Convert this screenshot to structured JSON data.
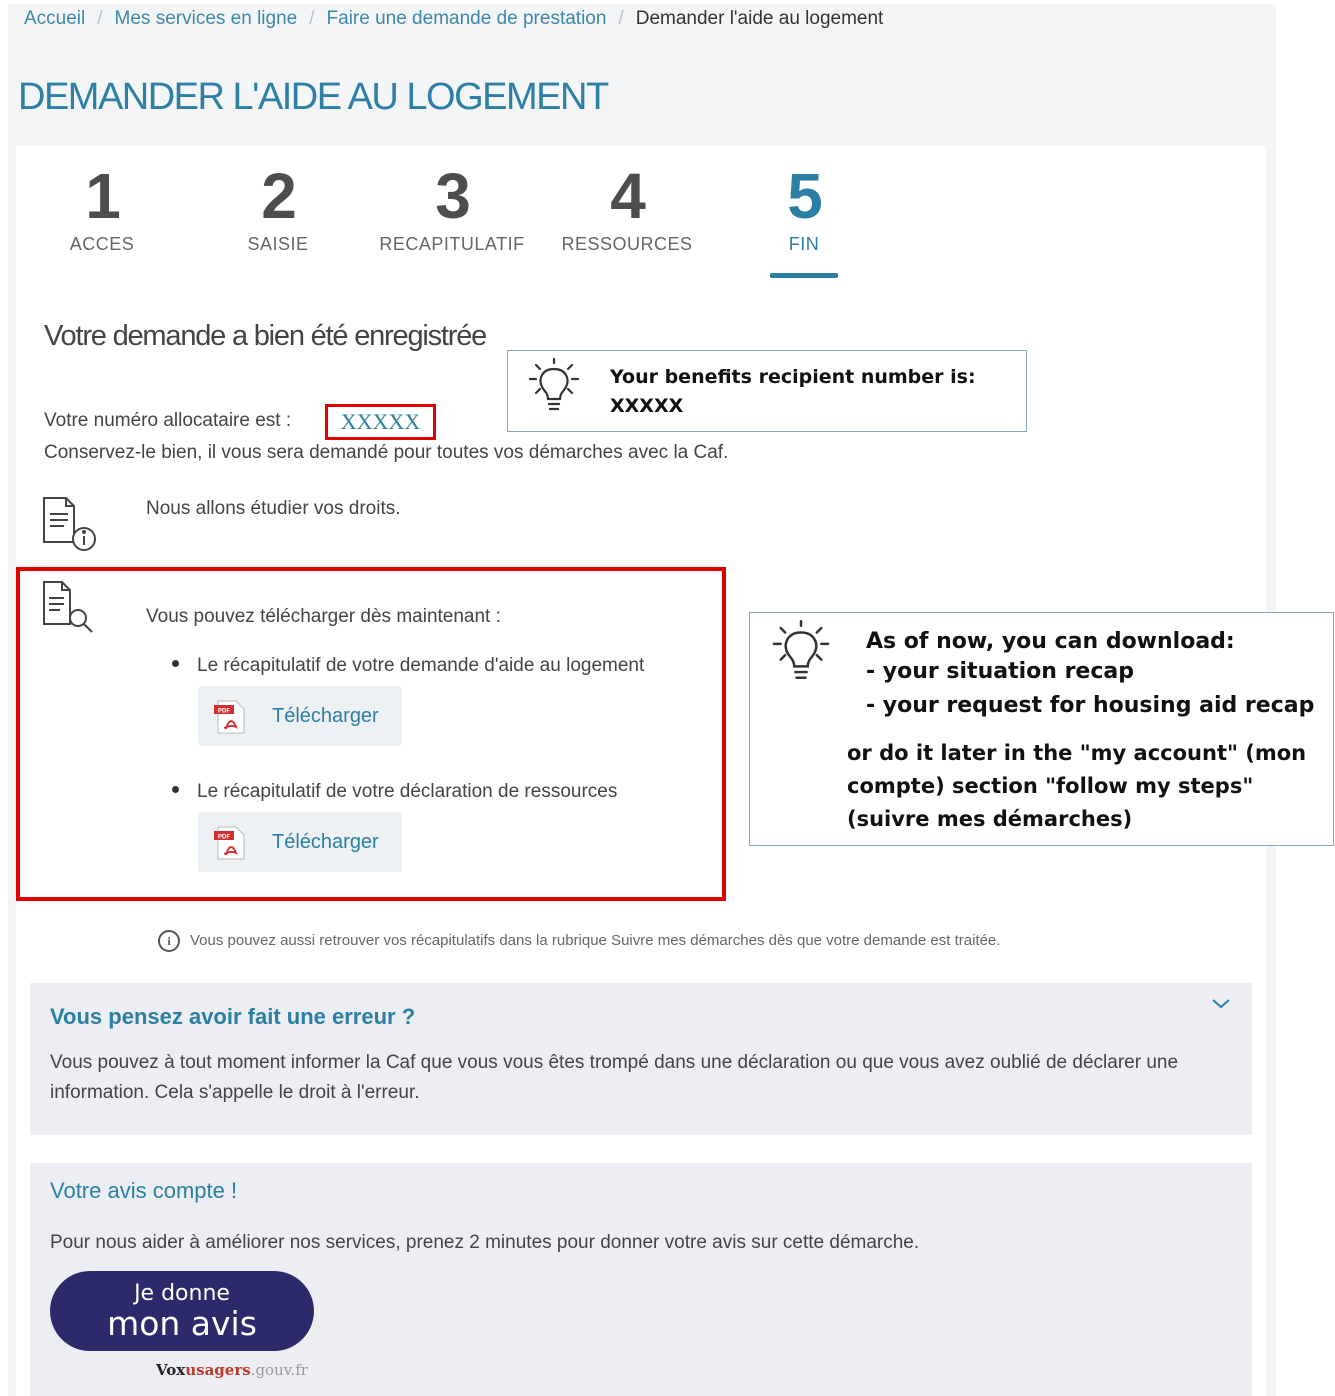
{
  "breadcrumb": {
    "items": [
      "Accueil",
      "Mes services en ligne",
      "Faire une demande de prestation"
    ],
    "current": "Demander l'aide au logement"
  },
  "page_title": "DEMANDER L'AIDE AU LOGEMENT",
  "steps": [
    {
      "number": "1",
      "label": "ACCES"
    },
    {
      "number": "2",
      "label": "SAISIE"
    },
    {
      "number": "3",
      "label": "RECAPITULATIF"
    },
    {
      "number": "4",
      "label": "RESSOURCES"
    },
    {
      "number": "5",
      "label": "FIN",
      "active": true
    }
  ],
  "confirmation": {
    "title": "Votre demande a bien été enregistrée",
    "alloc_label": "Votre numéro allocataire est :",
    "alloc_number": "XXXXX",
    "keep_text": "Conservez-le bien, il vous sera demandé pour toutes vos démarches avec la Caf.",
    "study_text": "Nous allons étudier vos droits."
  },
  "tooltip_top": {
    "line1": "Your benefits recipient number is:",
    "line2": "XXXXX"
  },
  "downloads": {
    "intro": "Vous pouvez télécharger dès maintenant :",
    "items": [
      {
        "label": "Le récapitulatif de votre demande d'aide au logement",
        "button": "Télécharger",
        "icon": "pdf-icon"
      },
      {
        "label": "Le récapitulatif de votre déclaration de ressources",
        "button": "Télécharger",
        "icon": "pdf-icon"
      }
    ]
  },
  "tooltip_side": {
    "heading": "As of now, you can download:",
    "items": [
      "- your situation recap",
      "- your request for housing aid recap"
    ],
    "footer": "or do it later in the \"my account\" (mon compte) section \"follow my steps\" (suivre mes démarches)"
  },
  "info_note": "Vous pouvez aussi retrouver vos récapitulatifs dans la rubrique Suivre mes démarches dès que votre demande est traitée.",
  "error_panel": {
    "title": "Vous pensez avoir fait une erreur ?",
    "body": "Vous pouvez à tout moment informer la Caf que vous vous êtes trompé dans une déclaration ou que vous avez oublié de déclarer une information. Cela s'appelle le droit à l'erreur."
  },
  "feedback_panel": {
    "title": "Votre avis compte !",
    "body": "Pour nous aider à améliorer nos services, prenez 2 minutes pour donner votre avis sur cette démarche.",
    "button_line1": "Je donne",
    "button_line2": "mon avis",
    "logo_part1": "Vox",
    "logo_part2": "usagers",
    "logo_part3": ".gouv.fr"
  },
  "colors": {
    "accent": "#2a7fa3",
    "highlight_border": "#e00000",
    "avis_button": "#2d2a6b"
  }
}
